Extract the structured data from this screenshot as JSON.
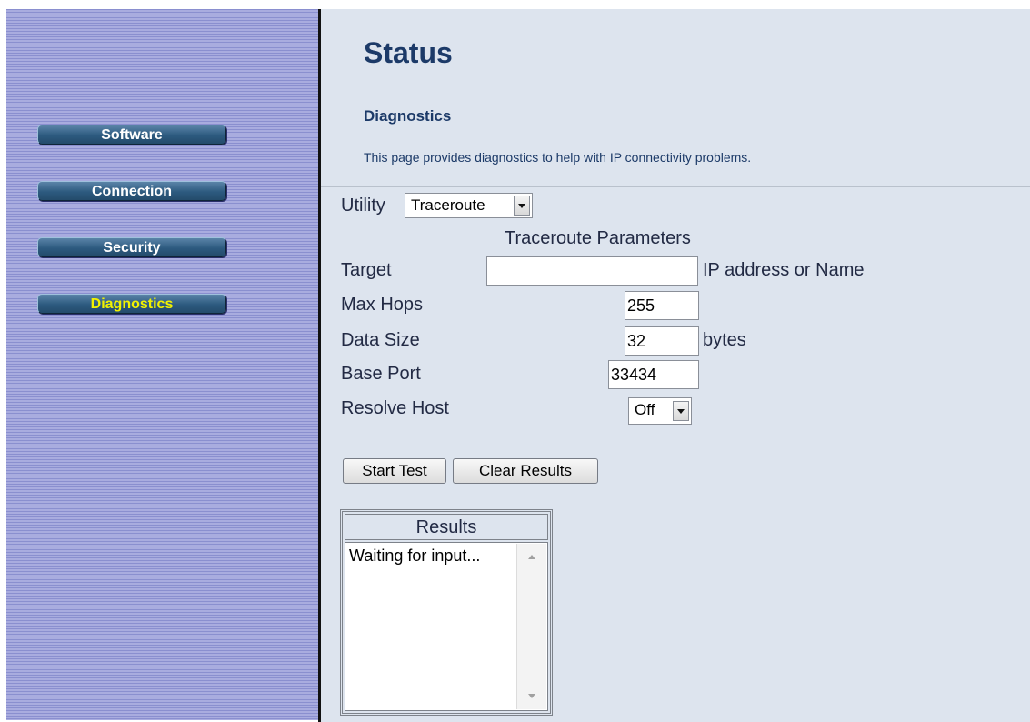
{
  "sidebar": {
    "items": [
      {
        "label": "Software",
        "active": false
      },
      {
        "label": "Connection",
        "active": false
      },
      {
        "label": "Security",
        "active": false
      },
      {
        "label": "Diagnostics",
        "active": true
      }
    ]
  },
  "page": {
    "title": "Status",
    "subtitle": "Diagnostics",
    "description": "This page provides diagnostics to help with IP connectivity problems."
  },
  "utility": {
    "label": "Utility",
    "selected": "Traceroute"
  },
  "params": {
    "heading": "Traceroute Parameters",
    "target_label": "Target",
    "target_value": "",
    "target_hint": "IP address or Name",
    "max_hops_label": "Max Hops",
    "max_hops_value": "255",
    "data_size_label": "Data Size",
    "data_size_value": "32",
    "data_size_unit": "bytes",
    "base_port_label": "Base Port",
    "base_port_value": "33434",
    "resolve_host_label": "Resolve Host",
    "resolve_host_value": "Off"
  },
  "actions": {
    "start_label": "Start Test",
    "clear_label": "Clear Results"
  },
  "results": {
    "heading": "Results",
    "text": "Waiting for input..."
  },
  "colors": {
    "active_nav_text": "#f2f200",
    "nav_text": "#ffffff",
    "heading": "#1c3a68"
  }
}
